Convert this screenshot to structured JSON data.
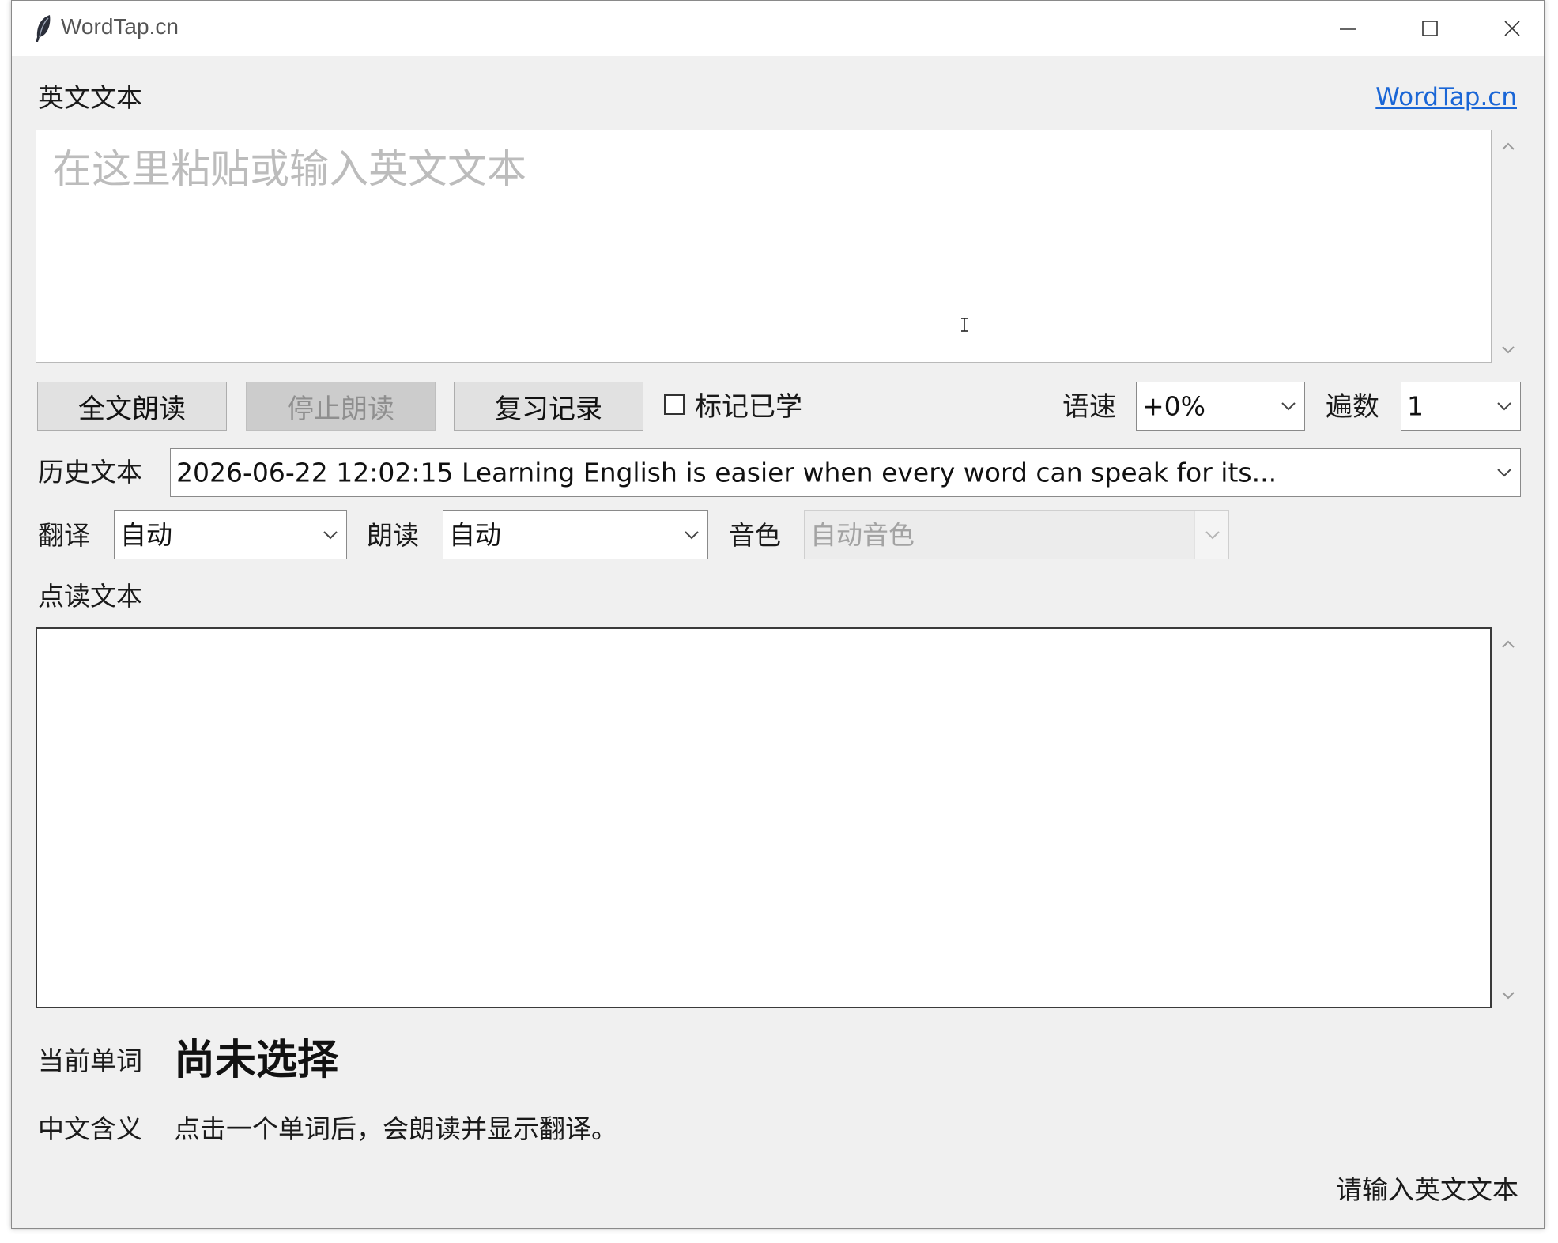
{
  "window": {
    "title": "WordTap.cn"
  },
  "english_section": {
    "label": "英文文本",
    "link_text": "WordTap.cn",
    "placeholder": "在这里粘贴或输入英文文本"
  },
  "controls": {
    "read_all": "全文朗读",
    "stop_read": "停止朗读",
    "review_history": "复习记录",
    "mark_learned_label": "标记已学",
    "mark_learned_checked": false,
    "speed_label": "语速",
    "speed_value": "+0%",
    "repeat_label": "遍数",
    "repeat_value": "1"
  },
  "history": {
    "label": "历史文本",
    "value": "2026-06-22 12:02:15  Learning English is easier when every word can speak for its..."
  },
  "options": {
    "translate_label": "翻译",
    "translate_value": "自动",
    "read_label": "朗读",
    "read_value": "自动",
    "voice_label": "音色",
    "voice_value": "自动音色"
  },
  "tap_section": {
    "label": "点读文本"
  },
  "current_word": {
    "label": "当前单词",
    "value": "尚未选择"
  },
  "meaning": {
    "label": "中文含义",
    "value": "点击一个单词后，会朗读并显示翻译。"
  },
  "status": {
    "text": "请输入英文文本"
  },
  "colors": {
    "window_bg": "#f0f0f0",
    "link": "#1a66d6",
    "button_bg": "#e1e1e1",
    "placeholder": "#bcbcbc"
  }
}
